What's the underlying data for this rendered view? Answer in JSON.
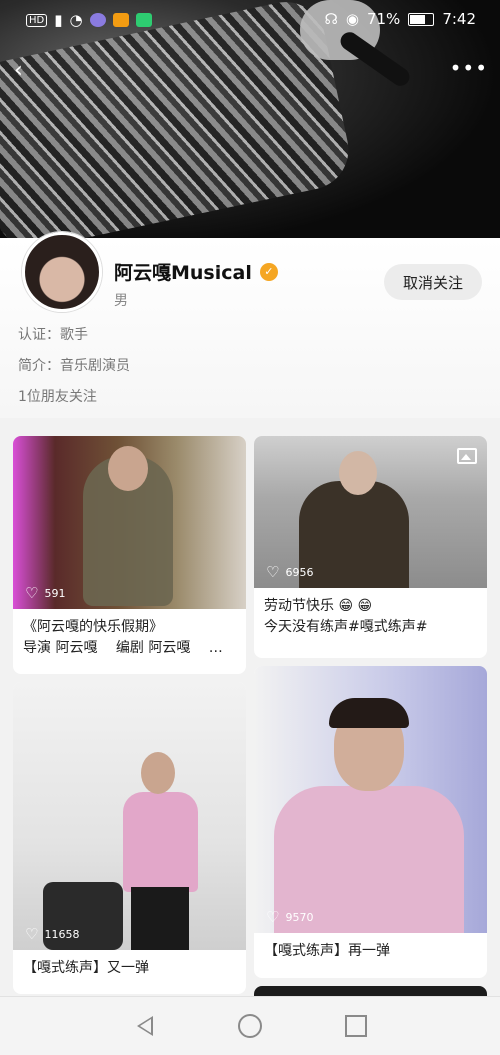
{
  "status_bar": {
    "left_icons": [
      "hd-icon",
      "signal-icon",
      "wifi-icon",
      "app1-icon",
      "app2-icon",
      "app3-icon"
    ],
    "hd_label": "HD",
    "battery": "71%",
    "time": "7:42"
  },
  "header": {
    "back_icon": "back-icon",
    "more_label": "•••"
  },
  "profile": {
    "name": "阿云嘎Musical",
    "gender": "男",
    "verification": "认证：歌手",
    "bio": "简介：音乐剧演员",
    "friends_following": "1位朋友关注",
    "unfollow_label": "取消关注",
    "verified_color": "#f5a623"
  },
  "posts": [
    {
      "likes": "591",
      "caption_line1": "《阿云嘎的快乐假期》",
      "caption_line2": "导演 阿云嘎　 编剧 阿云嘎　 …"
    },
    {
      "likes": "6956",
      "caption_line1": "劳动节快乐 😁 😁",
      "caption_line2": "今天没有练声#嘎式练声#",
      "media_icon": "image-icon"
    },
    {
      "likes": "11658",
      "caption_line1": "【嘎式练声】又一弹"
    },
    {
      "likes": "9570",
      "caption_line1": "【嘎式练声】再一弹"
    }
  ],
  "navbar": {
    "items": [
      "back-nav-icon",
      "home-nav-icon",
      "recents-nav-icon"
    ]
  }
}
